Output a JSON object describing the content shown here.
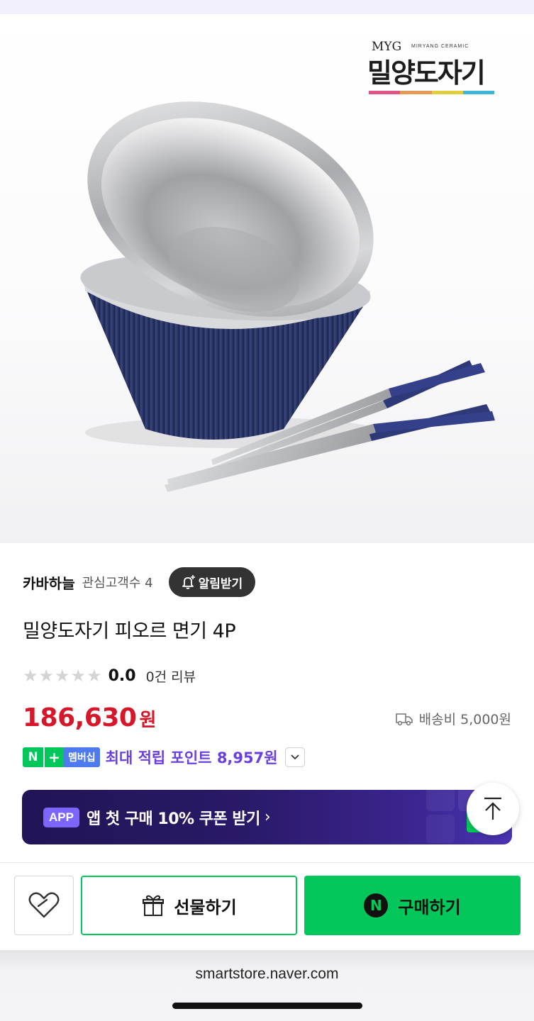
{
  "hero": {
    "image_icon": "product-photo-bowls-chopsticks",
    "brand_logo": {
      "abbr": "MYG",
      "english": "MIRYANG CERAMIC",
      "korean": "밀양도자기",
      "stripe_colors": [
        "#e05585",
        "#e39a57",
        "#e2cd3d",
        "#3fb6d8"
      ]
    }
  },
  "seller": {
    "name": "카바하늘",
    "followers_label": "관심고객수 4",
    "notify_label": "알림받기"
  },
  "product": {
    "title": "밀양도자기 피오르 면기 4P",
    "rating": {
      "stars_filled": 0,
      "stars_total": 5,
      "score": "0.0",
      "reviews_label": "0건 리뷰"
    },
    "price": {
      "amount": "186,630",
      "unit": "원",
      "color": "#d6172a"
    },
    "shipping": {
      "icon": "delivery-truck-icon",
      "label": "배송비 5,000원"
    },
    "points": {
      "badge_n": "N",
      "badge_plus": "+",
      "badge_membership": "멤버십",
      "text": "최대 적립 포인트 8,957원",
      "toggle_icon": "chevron-down-icon"
    }
  },
  "banner": {
    "badge": "APP",
    "text": "앱 첫 구매 10% 쿠폰 받기",
    "chevron": "›",
    "logo": "N"
  },
  "scroll_top_icon": "arrow-up-to-top-icon",
  "actions": {
    "wish_icon": "heart-icon",
    "gift_label": "선물하기",
    "gift_icon": "gift-icon",
    "buy_label": "구매하기",
    "buy_icon": "N",
    "accent": "#03c75a"
  },
  "browser": {
    "url": "smartstore.naver.com"
  }
}
